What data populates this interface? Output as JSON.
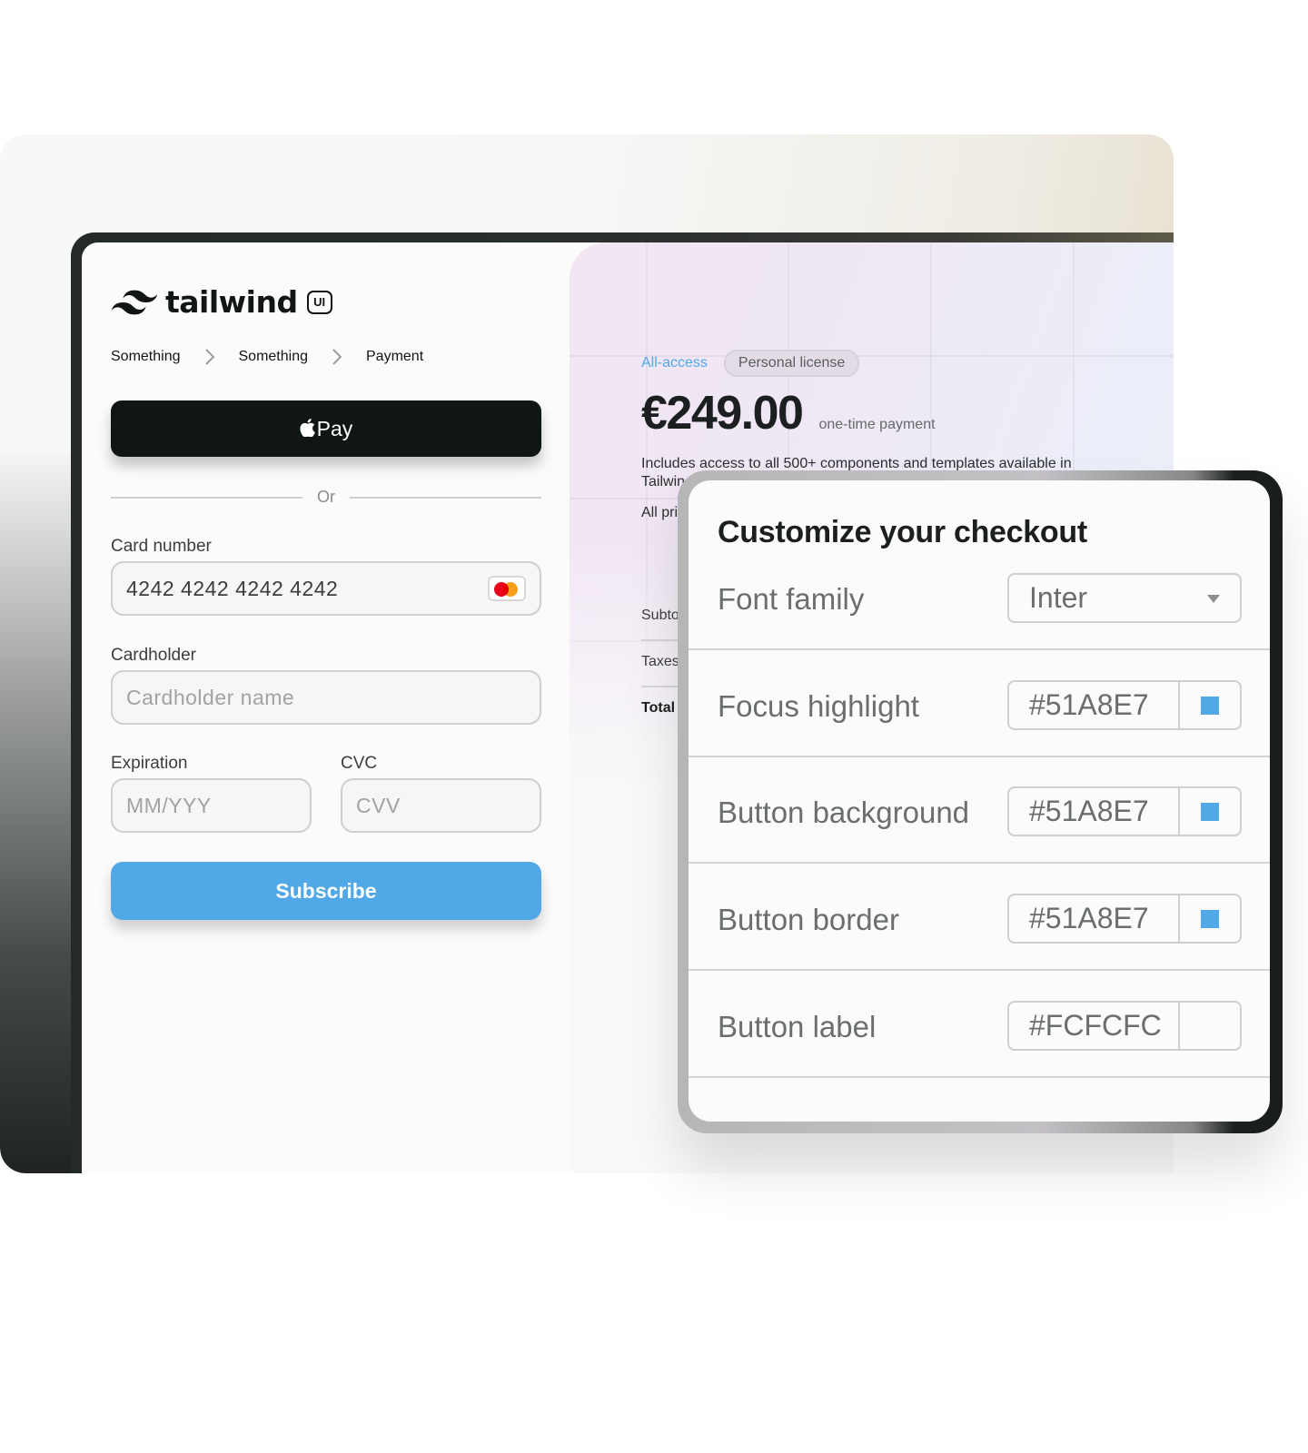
{
  "brand": {
    "name": "tailwind",
    "badge": "UI"
  },
  "breadcrumb": [
    {
      "label": "Something"
    },
    {
      "label": "Something"
    },
    {
      "label": "Payment"
    }
  ],
  "checkout": {
    "apple_pay_label": "Pay",
    "divider_label": "Or",
    "card_number": {
      "label": "Card number",
      "value": "4242 4242 4242 4242",
      "brand_icon": "mastercard-icon"
    },
    "cardholder": {
      "label": "Cardholder",
      "placeholder": "Cardholder name"
    },
    "expiration": {
      "label": "Expiration",
      "placeholder": "MM/YYY"
    },
    "cvc": {
      "label": "CVC",
      "placeholder": "CVV"
    },
    "subscribe_label": "Subscribe"
  },
  "summary": {
    "tabs": [
      {
        "label": "All-access",
        "active": true
      },
      {
        "label": "Personal license",
        "active": false
      }
    ],
    "price": "€249.00",
    "price_note": "one-time payment",
    "description": "Includes access to all 500+ components and templates available in Tailwin",
    "description2": "All pri",
    "rows": [
      {
        "label": "Subto"
      },
      {
        "label": "Taxes"
      },
      {
        "label": "Total"
      }
    ]
  },
  "customize": {
    "title": "Customize your checkout",
    "options": [
      {
        "label": "Font family",
        "type": "select",
        "value": "Inter"
      },
      {
        "label": "Focus highlight",
        "type": "color",
        "value": "#51A8E7",
        "swatch": "#51A8E7"
      },
      {
        "label": "Button background",
        "type": "color",
        "value": "#51A8E7",
        "swatch": "#51A8E7"
      },
      {
        "label": "Button border",
        "type": "color",
        "value": "#51A8E7",
        "swatch": "#51A8E7"
      },
      {
        "label": "Button label",
        "type": "color",
        "value": "#FCFCFC",
        "swatch": "#FCFCFC"
      }
    ]
  },
  "colors": {
    "accent": "#51A8E7",
    "dark_button": "#101515",
    "button_label": "#FCFCFC"
  }
}
